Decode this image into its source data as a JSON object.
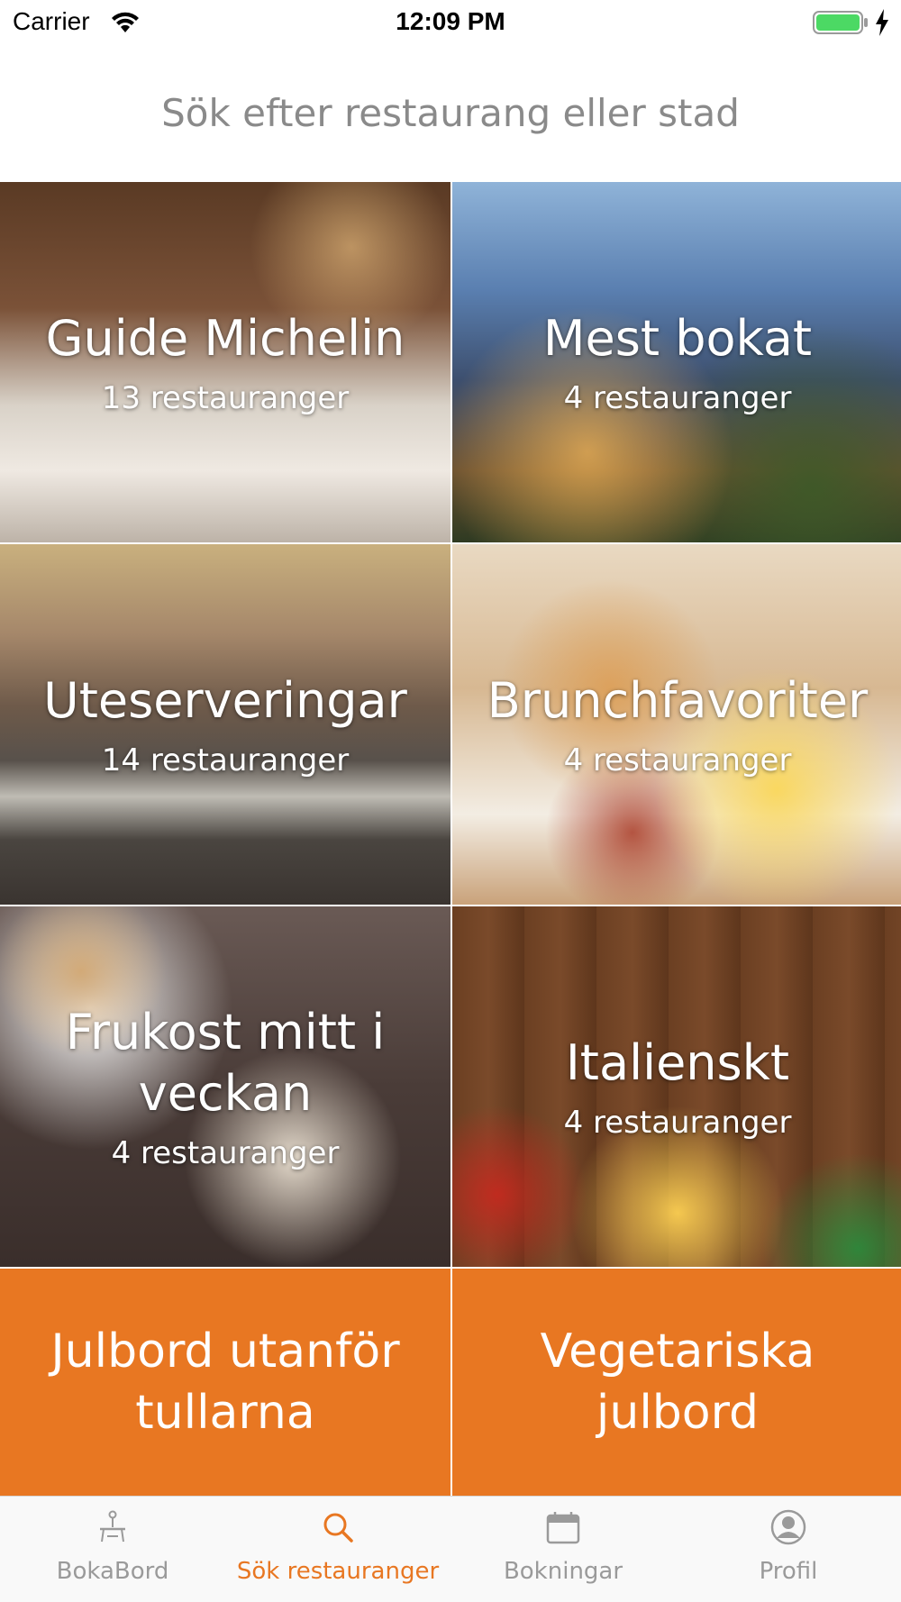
{
  "status_bar": {
    "carrier": "Carrier",
    "time": "12:09 PM"
  },
  "search": {
    "placeholder": "Sök efter restaurang eller stad"
  },
  "categories": [
    {
      "title": "Guide Michelin",
      "count": "13 restauranger"
    },
    {
      "title": "Mest bokat",
      "count": "4 restauranger"
    },
    {
      "title": "Uteserveringar",
      "count": "14 restauranger"
    },
    {
      "title": "Brunchfavoriter",
      "count": "4 restauranger"
    },
    {
      "title": "Frukost mitt i veckan",
      "count": "4 restauranger"
    },
    {
      "title": "Italienskt",
      "count": "4 restauranger"
    },
    {
      "title": "Julbord utanför tullarna"
    },
    {
      "title": "Vegetariska julbord"
    }
  ],
  "tabbar": {
    "tabs": [
      {
        "label": "BokaBord",
        "icon": "bokabord-icon"
      },
      {
        "label": "Sök restauranger",
        "icon": "search-icon",
        "active": true
      },
      {
        "label": "Bokningar",
        "icon": "calendar-icon"
      },
      {
        "label": "Profil",
        "icon": "profile-icon"
      }
    ]
  },
  "colors": {
    "accent": "#e87722",
    "tab_inactive": "#9a9a9a",
    "battery": "#4cd964"
  }
}
